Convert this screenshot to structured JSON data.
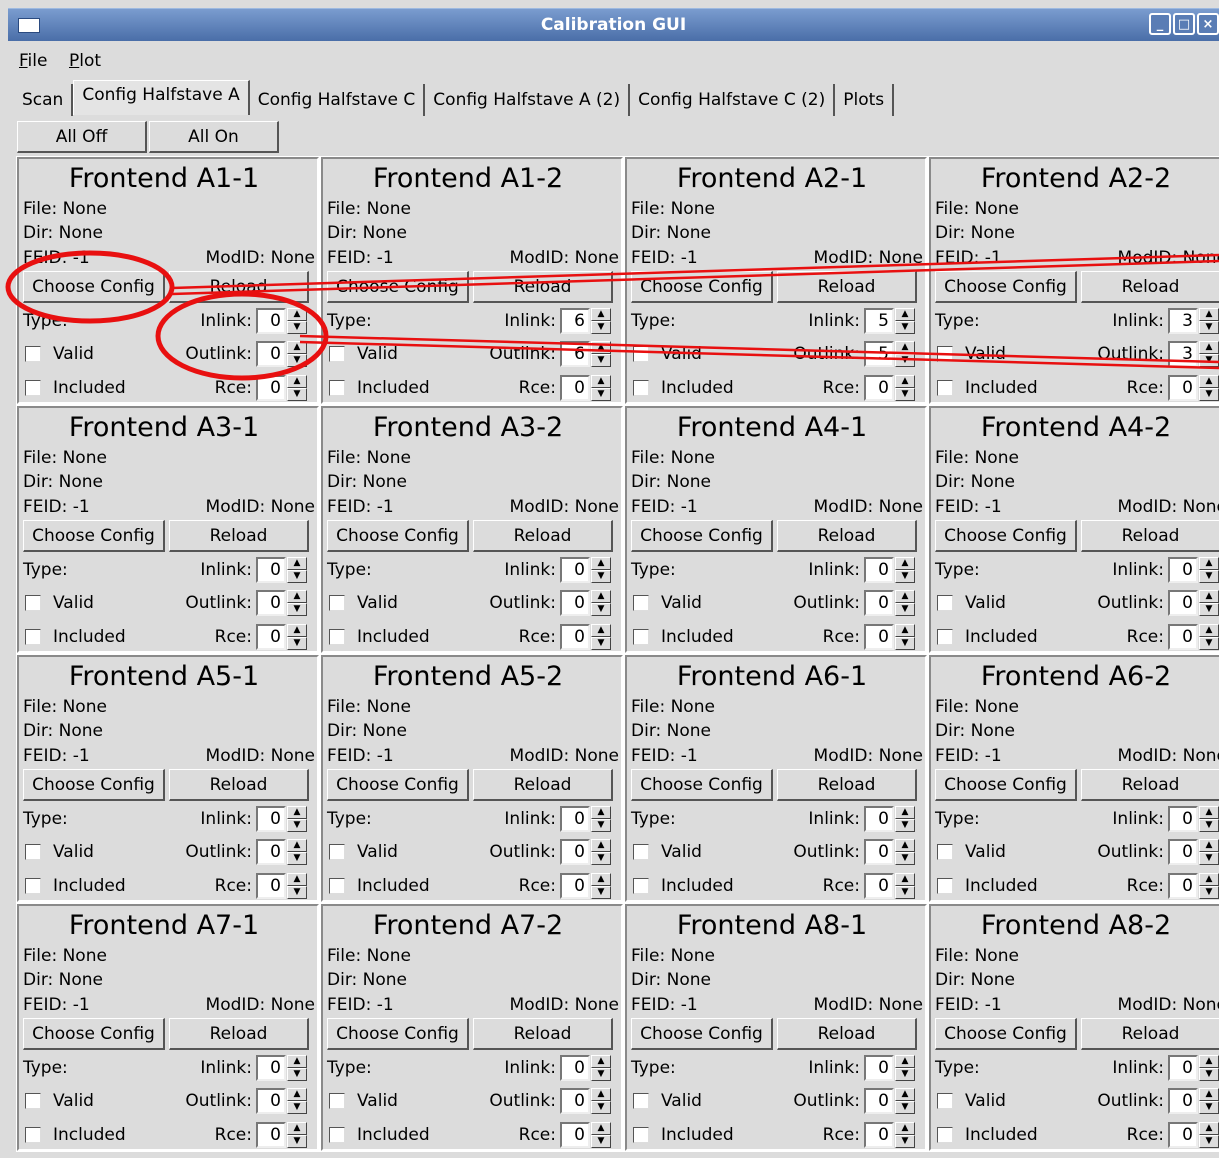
{
  "window": {
    "title": "Calibration GUI",
    "controls": [
      "_",
      "□",
      "×"
    ]
  },
  "menu": [
    {
      "label": "File",
      "accel": "F",
      "rest": "ile"
    },
    {
      "label": "Plot",
      "accel": "P",
      "rest": "lot"
    }
  ],
  "tabs": [
    "Scan",
    "Config Halfstave A",
    "Config Halfstave C",
    "Config Halfstave A (2)",
    "Config Halfstave C (2)",
    "Plots"
  ],
  "active_tab": 1,
  "toolbar": {
    "all_off": "All Off",
    "all_on": "All On"
  },
  "labels": {
    "file": "File: None",
    "dir": "Dir: None",
    "feid": "FEID: -1",
    "modid": "ModID: None",
    "choose": "Choose Config",
    "reload": "Reload",
    "type": "Type:",
    "inlink": "Inlink:",
    "outlink": "Outlink:",
    "rce": "Rce:",
    "valid": "Valid",
    "included": "Included"
  },
  "frontends": [
    {
      "title": "Frontend A1-1",
      "inlink": "0",
      "outlink": "0",
      "rce": "0"
    },
    {
      "title": "Frontend A1-2",
      "inlink": "6",
      "outlink": "6",
      "rce": "0"
    },
    {
      "title": "Frontend A2-1",
      "inlink": "5",
      "outlink": "5",
      "rce": "0"
    },
    {
      "title": "Frontend A2-2",
      "inlink": "3",
      "outlink": "3",
      "rce": "0"
    },
    {
      "title": "Frontend A3-1",
      "inlink": "0",
      "outlink": "0",
      "rce": "0"
    },
    {
      "title": "Frontend A3-2",
      "inlink": "0",
      "outlink": "0",
      "rce": "0"
    },
    {
      "title": "Frontend A4-1",
      "inlink": "0",
      "outlink": "0",
      "rce": "0"
    },
    {
      "title": "Frontend A4-2",
      "inlink": "0",
      "outlink": "0",
      "rce": "0"
    },
    {
      "title": "Frontend A5-1",
      "inlink": "0",
      "outlink": "0",
      "rce": "0"
    },
    {
      "title": "Frontend A5-2",
      "inlink": "0",
      "outlink": "0",
      "rce": "0"
    },
    {
      "title": "Frontend A6-1",
      "inlink": "0",
      "outlink": "0",
      "rce": "0"
    },
    {
      "title": "Frontend A6-2",
      "inlink": "0",
      "outlink": "0",
      "rce": "0"
    },
    {
      "title": "Frontend A7-1",
      "inlink": "0",
      "outlink": "0",
      "rce": "0"
    },
    {
      "title": "Frontend A7-2",
      "inlink": "0",
      "outlink": "0",
      "rce": "0"
    },
    {
      "title": "Frontend A8-1",
      "inlink": "0",
      "outlink": "0",
      "rce": "0"
    },
    {
      "title": "Frontend A8-2",
      "inlink": "0",
      "outlink": "0",
      "rce": "0"
    }
  ],
  "annotation_color": "#e81010"
}
